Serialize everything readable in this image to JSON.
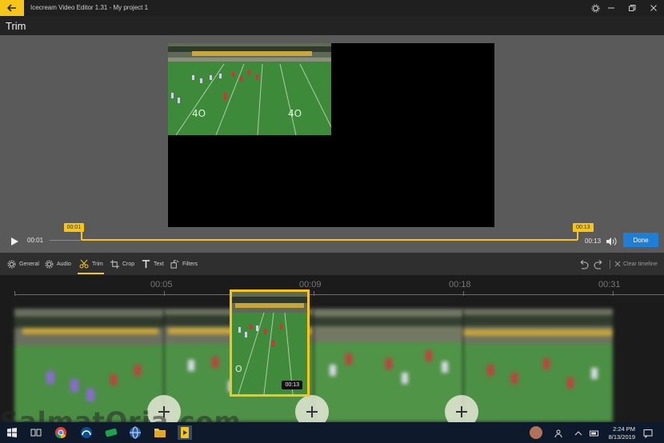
{
  "window": {
    "title": "Icecream Video Editor 1.31 - My project 1"
  },
  "page": {
    "heading": "Trim"
  },
  "player": {
    "current_time": "00:01",
    "total_time": "00:13",
    "trim_start_label": "00:01",
    "trim_end_label": "00:13",
    "trim_start_fraction": 0.06,
    "trim_end_fraction": 1.0,
    "done_label": "Done"
  },
  "toolbar": {
    "tools": [
      {
        "label": "General",
        "icon": "gear-icon"
      },
      {
        "label": "Audio",
        "icon": "audio-gear-icon"
      },
      {
        "label": "Trim",
        "icon": "scissors-icon",
        "active": true
      },
      {
        "label": "Crop",
        "icon": "crop-icon"
      },
      {
        "label": "Text",
        "icon": "text-t-icon"
      },
      {
        "label": "Filters",
        "icon": "filters-icon"
      }
    ],
    "clear_label": "Clear timeline"
  },
  "timeline": {
    "ruler_labels": [
      "00:05",
      "00:09",
      "00:18",
      "00:31"
    ],
    "selected_clip_duration": "00:13"
  },
  "watermark": {
    "text": "SalmatOria.com"
  },
  "taskbar": {
    "time": "2:24 PM",
    "date": "8/13/2019"
  },
  "colors": {
    "accent": "#f5c518",
    "done_button": "#1f7ed6",
    "taskbar": "#0e1a2b"
  }
}
